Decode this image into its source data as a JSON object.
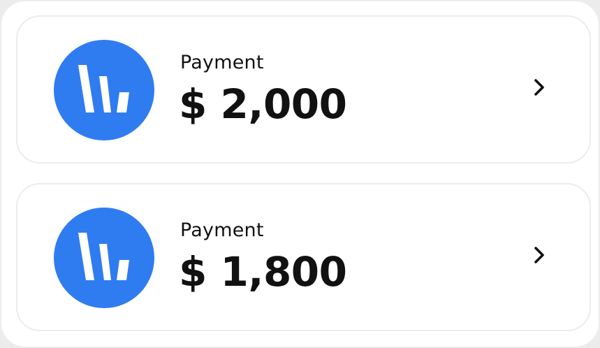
{
  "colors": {
    "accent": "#2f7cf0",
    "text": "#111111",
    "card_background": "#ffffff",
    "border": "#ececec"
  },
  "payments": [
    {
      "label": "Payment",
      "amount": "$ 2,000",
      "icon": "bar-chart-icon",
      "action_icon": "chevron-right-icon"
    },
    {
      "label": "Payment",
      "amount": "$ 1,800",
      "icon": "bar-chart-icon",
      "action_icon": "chevron-right-icon"
    }
  ]
}
